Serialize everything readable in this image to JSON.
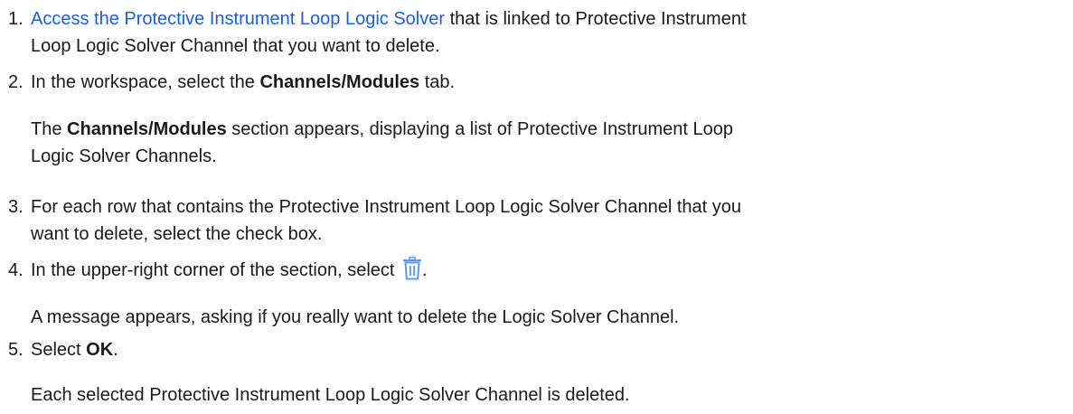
{
  "steps": [
    {
      "number": "1.",
      "link_text": "Access the Protective Instrument Loop Logic Solver",
      "text_line1_rest": " that is linked to Protective Instrument",
      "text_line2": "Loop Logic Solver Channel that you want to delete."
    },
    {
      "number": "2.",
      "text_before": "In the workspace, select the ",
      "bold": "Channels/Modules",
      "text_after": " tab.",
      "result_before": "The ",
      "result_bold": "Channels/Modules",
      "result_line1_rest": " section appears, displaying a list of Protective Instrument Loop",
      "result_line2": "Logic Solver Channels."
    },
    {
      "number": "3.",
      "text_line1": "For each row that contains the Protective Instrument Loop Logic Solver Channel that you",
      "text_line2": "want to delete, select the check box."
    },
    {
      "number": "4.",
      "text_before": "In the upper-right corner of the section, select ",
      "icon": "trash-icon",
      "text_after": ".",
      "result": "A message appears, asking if you really want to delete the Logic Solver Channel."
    },
    {
      "number": "5.",
      "text_before": "Select ",
      "bold": "OK",
      "text_after": ".",
      "result": "Each selected Protective Instrument Loop Logic Solver Channel is deleted."
    }
  ],
  "colors": {
    "link": "#1f5fd1",
    "icon": "#5b9be8",
    "text": "#1a1a1a"
  }
}
